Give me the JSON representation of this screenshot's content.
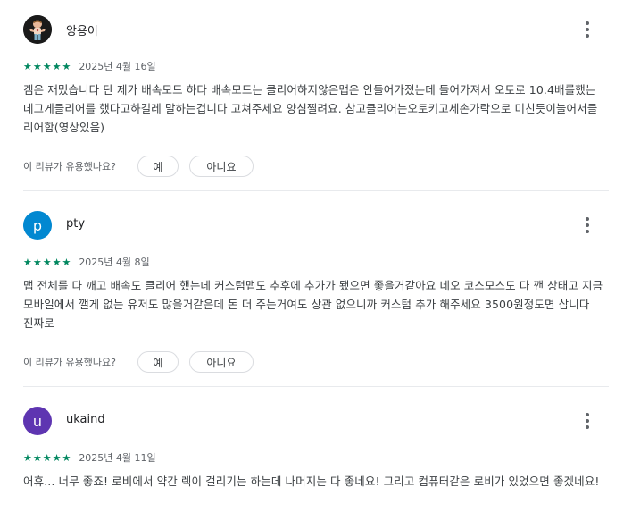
{
  "helpful": {
    "question": "이 리뷰가 유용했나요?",
    "yes_label": "예",
    "no_label": "아니요"
  },
  "colors": {
    "star": "#01875f",
    "avatar_p": "#0288d1",
    "avatar_u": "#5e35b1",
    "avatar_photo_bg": "#1a1a1a"
  },
  "reviews": [
    {
      "name": "앙용이",
      "avatar_letter": "",
      "avatar_icon": "character-photo-icon",
      "rating": 5,
      "stars": "★★★★★",
      "date": "2025년 4월 16일",
      "text": "겜은 재밌습니다 단 제가 배속모드 하다 배속모드는 클리어하지않은맵은 안들어가졌는데 들어가져서 오토로 10.4배를했는데그게클리어를 했다고하길레 말하는겁니다 고쳐주세요 양심찔려요. 참고클리어는오토키고세손가락으로 미친듯이눌어서클리어함(영상있음)"
    },
    {
      "name": "pty",
      "avatar_letter": "p",
      "rating": 5,
      "stars": "★★★★★",
      "date": "2025년 4월 8일",
      "text": "맵 전체를 다 깨고 배속도 클리어 했는데 커스텀맵도 추후에 추가가 됐으면 좋을거같아요 네오 코스모스도 다 깬 상태고 지금 모바일에서 깰게 없는 유저도 많을거같은데 돈 더 주는거여도 상관 없으니까 커스텀 추가 해주세요 3500원정도면 삽니다 진짜로"
    },
    {
      "name": "ukaind",
      "avatar_letter": "u",
      "rating": 5,
      "stars": "★★★★★",
      "date": "2025년 4월 11일",
      "text": "어휴... 너무 좋죠! 로비에서 약간 렉이 걸리기는 하는데 나머지는 다 좋네요! 그리고 컴퓨터같은 로비가 있었으면 좋겠네요!"
    }
  ]
}
